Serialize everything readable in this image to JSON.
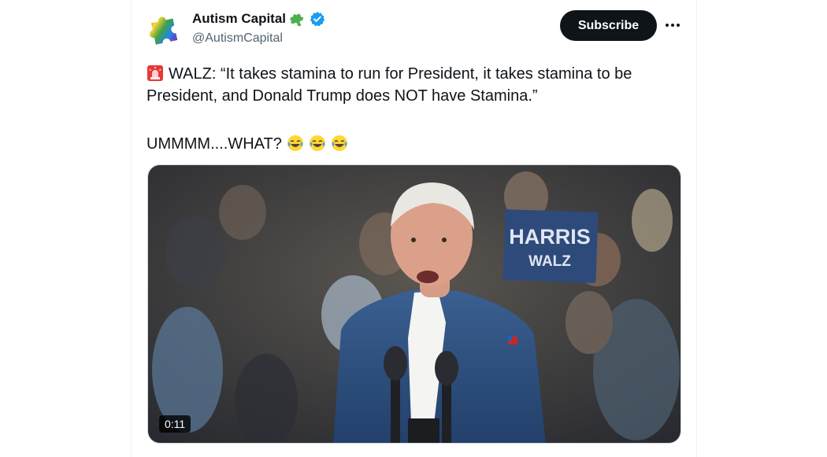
{
  "account": {
    "display_name": "Autism Capital",
    "handle": "@AutismCapital",
    "verified": true,
    "avatar_icon": "rainbow-puzzle-piece-icon",
    "name_emoji": "puzzle-piece-emoji"
  },
  "actions": {
    "subscribe_label": "Subscribe",
    "more_icon": "more-dots-icon"
  },
  "tweet": {
    "line1": "WALZ: “It takes stamina to run for President, it takes stamina to be",
    "line2": "President, and Donald Trump does NOT have Stamina.”",
    "line3": "UMMMM....WHAT?",
    "lead_emoji": "rotating-light-emoji",
    "trail_emoji": [
      "tears-of-joy-emoji",
      "tears-of-joy-emoji",
      "tears-of-joy-emoji"
    ]
  },
  "media": {
    "type": "video",
    "duration": "0:11",
    "sign_line1": "HARRIS",
    "sign_line2": "WALZ"
  },
  "colors": {
    "text": "#0f1419",
    "secondary": "#536471",
    "verified": "#1d9bf0",
    "button_bg": "#0f1419"
  }
}
